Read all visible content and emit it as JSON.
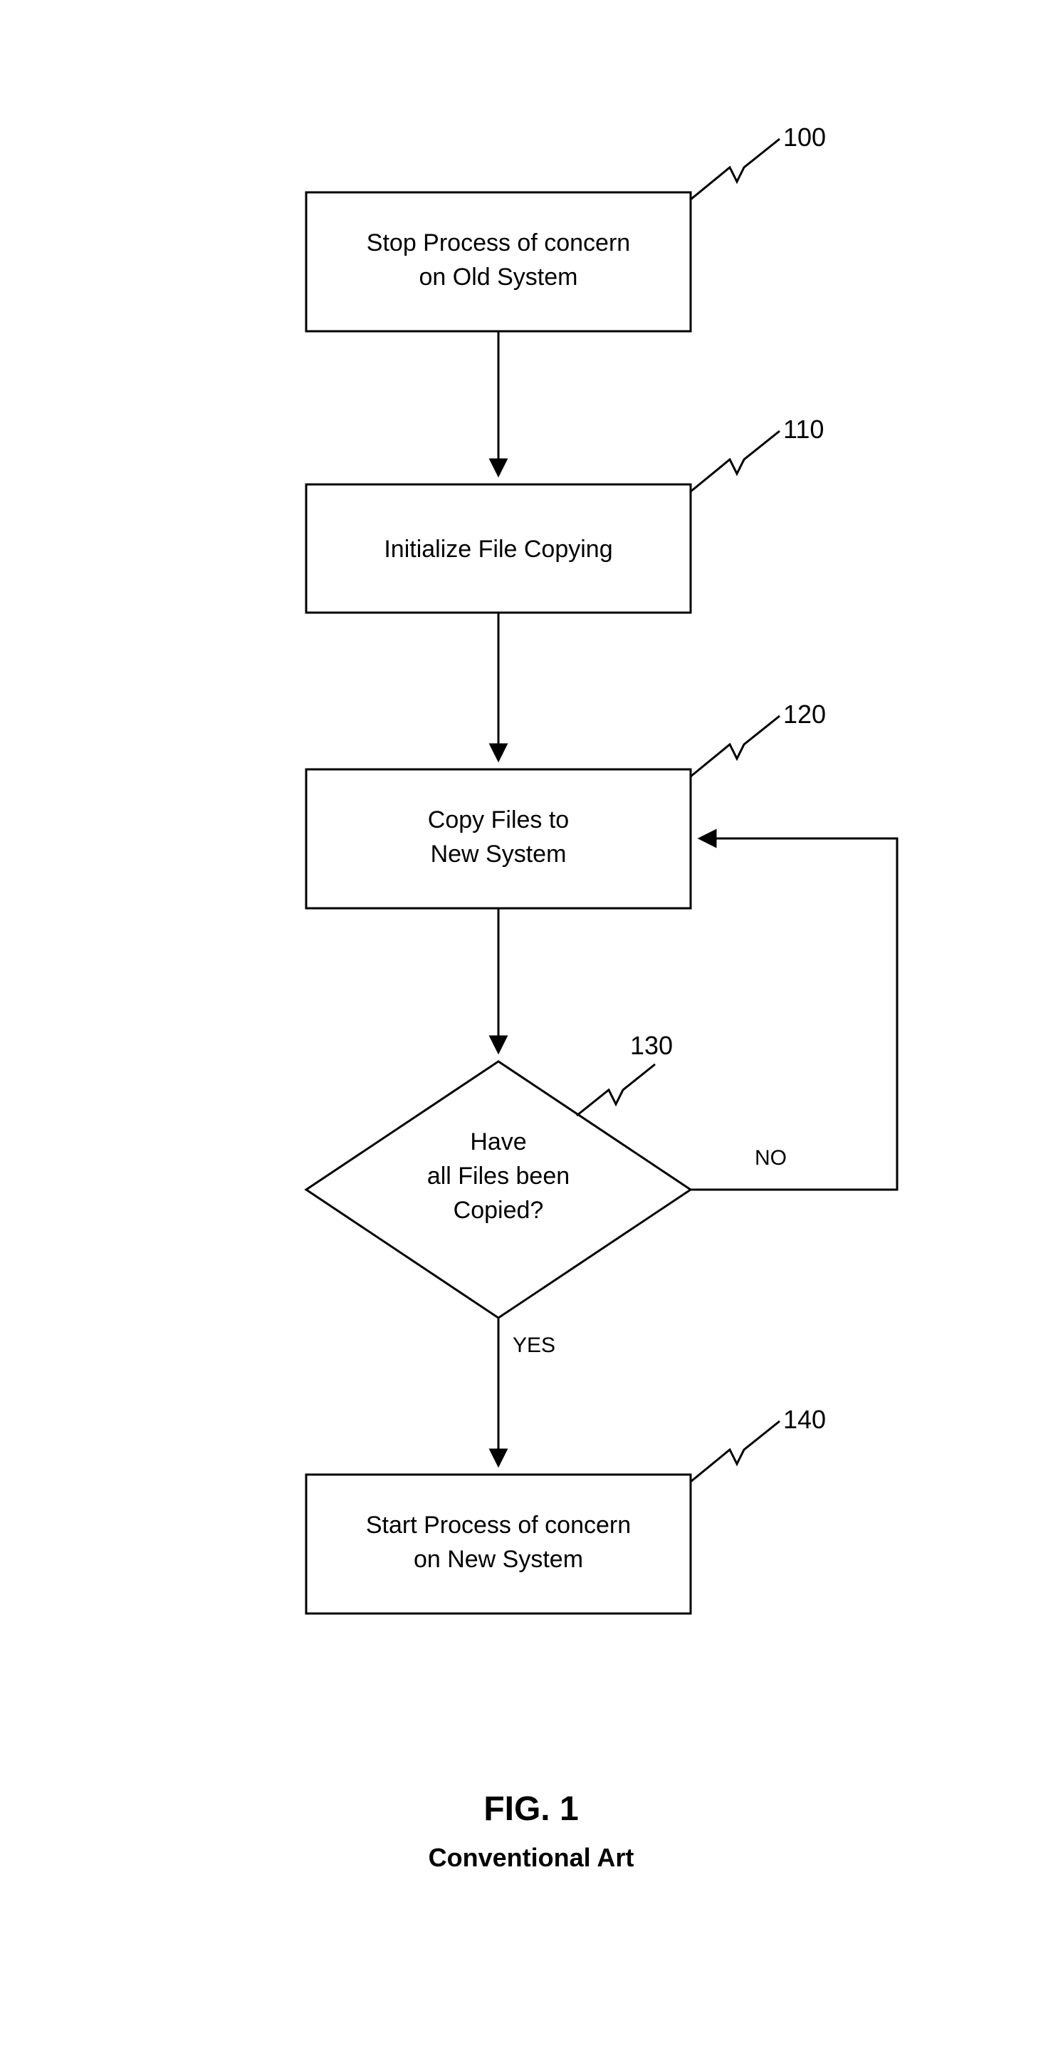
{
  "flow": {
    "box100": {
      "ref": "100",
      "line1": "Stop Process of concern",
      "line2": "on Old System"
    },
    "box110": {
      "ref": "110",
      "line1": "Initialize File Copying"
    },
    "box120": {
      "ref": "120",
      "line1": "Copy Files to",
      "line2": "New System"
    },
    "diamond130": {
      "ref": "130",
      "line1": "Have",
      "line2": "all Files been",
      "line3": "Copied?",
      "yes": "YES",
      "no": "NO"
    },
    "box140": {
      "ref": "140",
      "line1": "Start Process of concern",
      "line2": "on New System"
    }
  },
  "figure": {
    "title": "FIG. 1",
    "subtitle": "Conventional Art"
  }
}
